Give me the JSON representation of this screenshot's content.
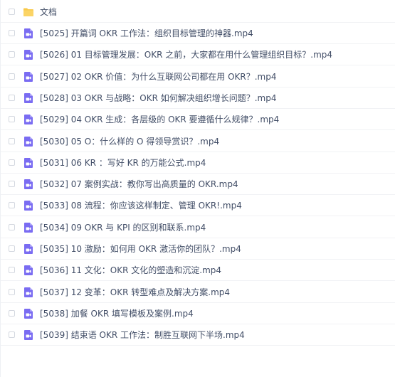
{
  "folder": {
    "name": "文档",
    "icon": "folder-icon",
    "color": "#f9c94a"
  },
  "files": [
    {
      "name": "[5025] 开篇词 OKR 工作法：组织目标管理的神器.mp4",
      "icon": "video-file-icon"
    },
    {
      "name": "[5026] 01 目标管理发展：OKR 之前，大家都在用什么管理组织目标？.mp4",
      "icon": "video-file-icon"
    },
    {
      "name": "[5027] 02 OKR 价值：为什么互联网公司都在用 OKR？.mp4",
      "icon": "video-file-icon"
    },
    {
      "name": "[5028] 03 OKR 与战略：OKR 如何解决组织增长问题？.mp4",
      "icon": "video-file-icon"
    },
    {
      "name": "[5029] 04 OKR 生成：各层级的 OKR 要遵循什么规律？.mp4",
      "icon": "video-file-icon"
    },
    {
      "name": "[5030] 05 O：什么样的 O 得领导赏识？.mp4",
      "icon": "video-file-icon"
    },
    {
      "name": "[5031] 06 KR ：写好 KR 的万能公式.mp4",
      "icon": "video-file-icon"
    },
    {
      "name": "[5032] 07 案例实战：教你写出高质量的 OKR.mp4",
      "icon": "video-file-icon"
    },
    {
      "name": "[5033] 08 流程：你应该这样制定、管理 OKR!.mp4",
      "icon": "video-file-icon"
    },
    {
      "name": "[5034] 09 OKR 与 KPI 的区别和联系.mp4",
      "icon": "video-file-icon"
    },
    {
      "name": "[5035] 10 激励：如何用 OKR 激活你的团队？.mp4",
      "icon": "video-file-icon"
    },
    {
      "name": "[5036] 11 文化：OKR 文化的塑造和沉淀.mp4",
      "icon": "video-file-icon"
    },
    {
      "name": "[5037] 12 变革：OKR 转型难点及解决方案.mp4",
      "icon": "video-file-icon"
    },
    {
      "name": "[5038] 加餐 OKR 填写模板及案例.mp4",
      "icon": "video-file-icon"
    },
    {
      "name": "[5039] 结束语 OKR 工作法：制胜互联网下半场.mp4",
      "icon": "video-file-icon"
    }
  ],
  "colors": {
    "video_icon": "#7a6cf2",
    "text": "#424e67",
    "checkbox_border": "#d4d8e0",
    "row_divider": "#f1f2f5"
  }
}
